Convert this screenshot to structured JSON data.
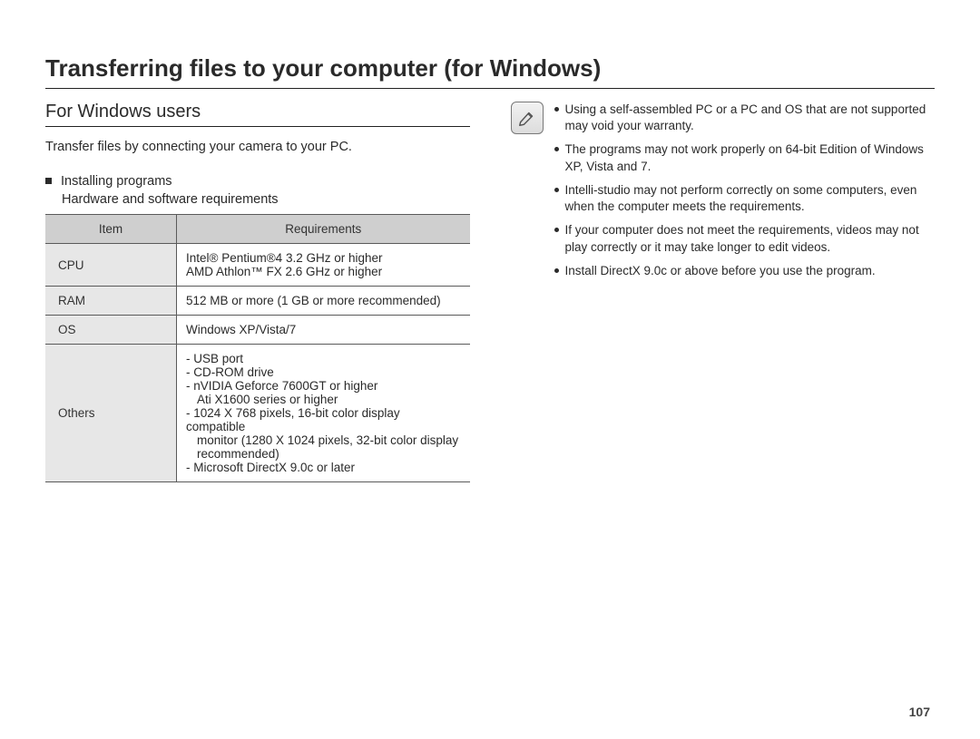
{
  "title": "Transferring files to your computer (for Windows)",
  "left": {
    "subheading": "For Windows users",
    "intro": "Transfer files by connecting your camera to your PC.",
    "installing_label": "Installing programs",
    "hwsw_label": "Hardware and software requirements",
    "table": {
      "header_item": "Item",
      "header_req": "Requirements",
      "rows": {
        "cpu_label": "CPU",
        "cpu_line1": "Intel® Pentium®4 3.2 GHz or higher",
        "cpu_line2": "AMD Athlon™ FX 2.6 GHz or higher",
        "ram_label": "RAM",
        "ram_value": "512 MB or more (1 GB or more recommended)",
        "os_label": "OS",
        "os_value": "Windows XP/Vista/7",
        "others_label": "Others",
        "others_l1": "- USB port",
        "others_l2": "- CD-ROM drive",
        "others_l3": "- nVIDIA Geforce 7600GT or higher",
        "others_l3b": "Ati X1600 series or higher",
        "others_l4": "- 1024 X 768 pixels, 16-bit color display compatible",
        "others_l4b": "monitor (1280 X 1024 pixels, 32-bit color display",
        "others_l4c": "recommended)",
        "others_l5": "- Microsoft DirectX 9.0c or later"
      }
    }
  },
  "right": {
    "notes": {
      "n1": "Using a self-assembled  PC or a PC and OS that are not supported may void your warranty.",
      "n2": "The programs may not work properly on 64-bit Edition of Windows XP, Vista and 7.",
      "n3": "Intelli-studio may not perform correctly on some computers, even when the computer meets the requirements.",
      "n4": "If your computer does not meet the requirements, videos may not play correctly or it may take longer to edit videos.",
      "n5": "Install DirectX 9.0c or above before you use the program."
    }
  },
  "page_number": "107"
}
